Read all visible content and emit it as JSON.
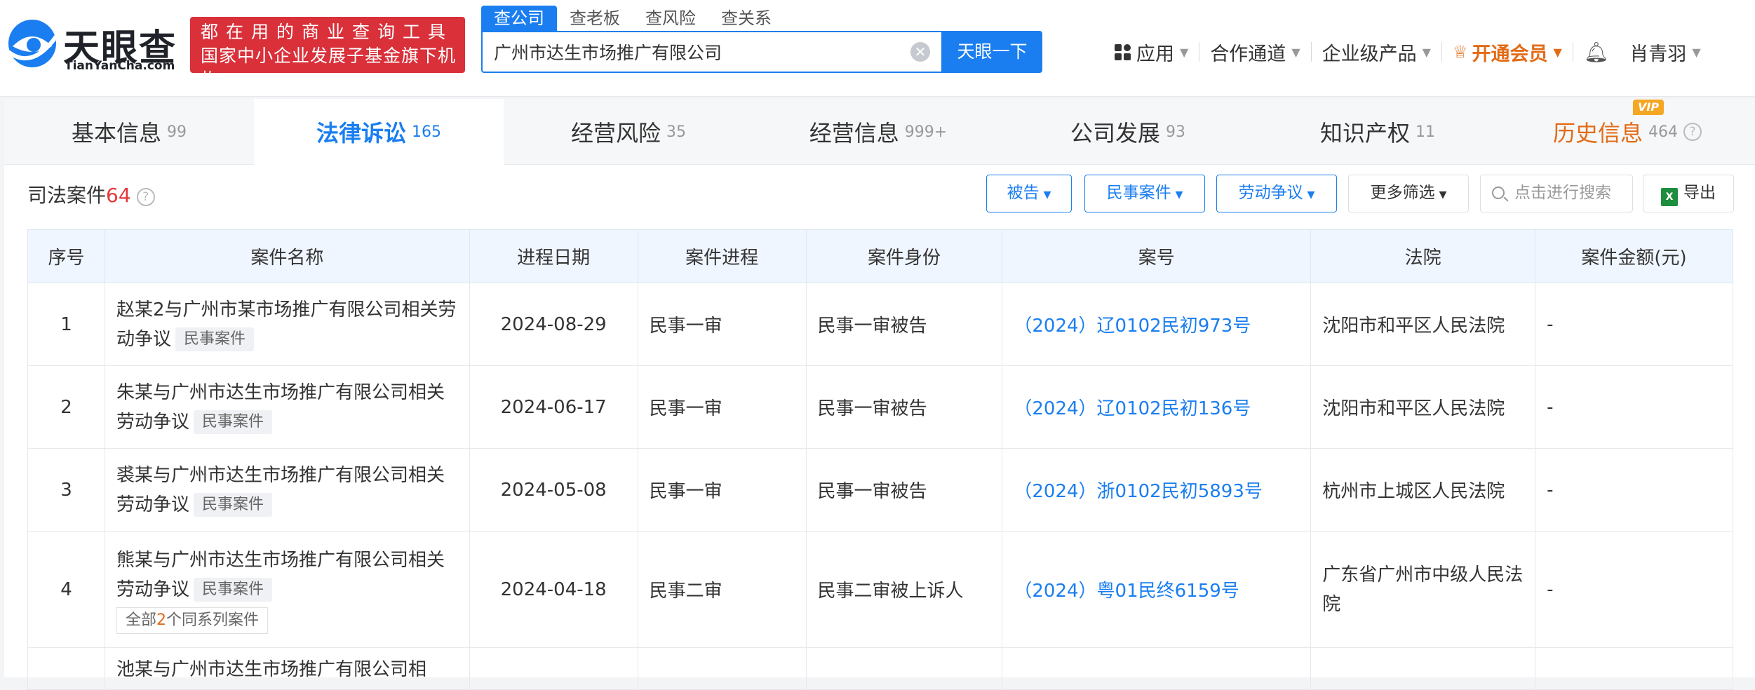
{
  "brand": {
    "name": "天眼查",
    "domain": "TianYanCha.com"
  },
  "promo": {
    "line1": "都在用的商业查询工具",
    "line2": "国家中小企业发展子基金旗下机构"
  },
  "search": {
    "tabs": [
      "查公司",
      "查老板",
      "查风险",
      "查关系"
    ],
    "value": "广州市达生市场推广有限公司",
    "button": "天眼一下"
  },
  "nav": {
    "apps": "应用",
    "partner": "合作通道",
    "enterprise": "企业级产品",
    "vip": "开通会员",
    "user": "肖青羽"
  },
  "main_tabs": [
    {
      "name": "基本信息",
      "count": "99"
    },
    {
      "name": "法律诉讼",
      "count": "165"
    },
    {
      "name": "经营风险",
      "count": "35"
    },
    {
      "name": "经营信息",
      "count": "999+"
    },
    {
      "name": "公司发展",
      "count": "93"
    },
    {
      "name": "知识产权",
      "count": "11"
    },
    {
      "name": "历史信息",
      "count": "464"
    }
  ],
  "vip_tag": "VIP",
  "section": {
    "title": "司法案件",
    "count": "64"
  },
  "filters": {
    "defendant": "被告",
    "civil": "民事案件",
    "labor": "劳动争议",
    "more": "更多筛选",
    "search_placeholder": "点击进行搜索",
    "export": "导出"
  },
  "table": {
    "headers": [
      "序号",
      "案件名称",
      "进程日期",
      "案件进程",
      "案件身份",
      "案号",
      "法院",
      "案件金额(元)"
    ],
    "rows": [
      {
        "no": "1",
        "name": "赵某2与广州市某市场推广有限公司相关劳动争议",
        "tag": "民事案件",
        "date": "2024-08-29",
        "stage": "民事一审",
        "role": "民事一审被告",
        "case_no": "（2024）辽0102民初973号",
        "court": "沈阳市和平区人民法院",
        "amount": "-"
      },
      {
        "no": "2",
        "name": "朱某与广州市达生市场推广有限公司相关劳动争议",
        "tag": "民事案件",
        "date": "2024-06-17",
        "stage": "民事一审",
        "role": "民事一审被告",
        "case_no": "（2024）辽0102民初136号",
        "court": "沈阳市和平区人民法院",
        "amount": "-"
      },
      {
        "no": "3",
        "name": "裘某与广州市达生市场推广有限公司相关劳动争议",
        "tag": "民事案件",
        "date": "2024-05-08",
        "stage": "民事一审",
        "role": "民事一审被告",
        "case_no": "（2024）浙0102民初5893号",
        "court": "杭州市上城区人民法院",
        "amount": "-"
      },
      {
        "no": "4",
        "name": "熊某与广州市达生市场推广有限公司相关劳动争议",
        "tag": "民事案件",
        "series_prefix": "全部",
        "series_count": "2",
        "series_suffix": "个同系列案件",
        "date": "2024-04-18",
        "stage": "民事二审",
        "role": "民事二审被上诉人",
        "case_no": "（2024）粤01民终6159号",
        "court": "广东省广州市中级人民法院",
        "amount": "-"
      },
      {
        "name": "池某与广州市达生市场推广有限公司相"
      }
    ]
  }
}
